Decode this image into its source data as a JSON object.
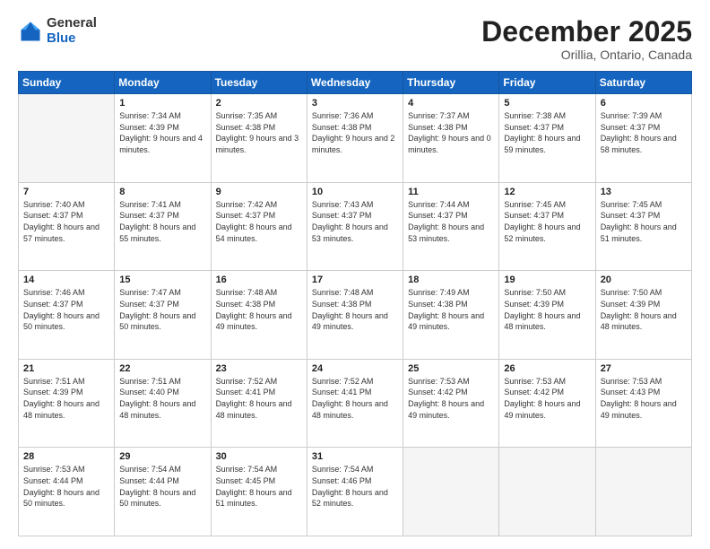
{
  "logo": {
    "general": "General",
    "blue": "Blue"
  },
  "header": {
    "title": "December 2025",
    "subtitle": "Orillia, Ontario, Canada"
  },
  "days": [
    "Sunday",
    "Monday",
    "Tuesday",
    "Wednesday",
    "Thursday",
    "Friday",
    "Saturday"
  ],
  "weeks": [
    [
      {
        "day": "",
        "sunrise": "",
        "sunset": "",
        "daylight": ""
      },
      {
        "day": "1",
        "sunrise": "Sunrise: 7:34 AM",
        "sunset": "Sunset: 4:39 PM",
        "daylight": "Daylight: 9 hours and 4 minutes."
      },
      {
        "day": "2",
        "sunrise": "Sunrise: 7:35 AM",
        "sunset": "Sunset: 4:38 PM",
        "daylight": "Daylight: 9 hours and 3 minutes."
      },
      {
        "day": "3",
        "sunrise": "Sunrise: 7:36 AM",
        "sunset": "Sunset: 4:38 PM",
        "daylight": "Daylight: 9 hours and 2 minutes."
      },
      {
        "day": "4",
        "sunrise": "Sunrise: 7:37 AM",
        "sunset": "Sunset: 4:38 PM",
        "daylight": "Daylight: 9 hours and 0 minutes."
      },
      {
        "day": "5",
        "sunrise": "Sunrise: 7:38 AM",
        "sunset": "Sunset: 4:37 PM",
        "daylight": "Daylight: 8 hours and 59 minutes."
      },
      {
        "day": "6",
        "sunrise": "Sunrise: 7:39 AM",
        "sunset": "Sunset: 4:37 PM",
        "daylight": "Daylight: 8 hours and 58 minutes."
      }
    ],
    [
      {
        "day": "7",
        "sunrise": "Sunrise: 7:40 AM",
        "sunset": "Sunset: 4:37 PM",
        "daylight": "Daylight: 8 hours and 57 minutes."
      },
      {
        "day": "8",
        "sunrise": "Sunrise: 7:41 AM",
        "sunset": "Sunset: 4:37 PM",
        "daylight": "Daylight: 8 hours and 55 minutes."
      },
      {
        "day": "9",
        "sunrise": "Sunrise: 7:42 AM",
        "sunset": "Sunset: 4:37 PM",
        "daylight": "Daylight: 8 hours and 54 minutes."
      },
      {
        "day": "10",
        "sunrise": "Sunrise: 7:43 AM",
        "sunset": "Sunset: 4:37 PM",
        "daylight": "Daylight: 8 hours and 53 minutes."
      },
      {
        "day": "11",
        "sunrise": "Sunrise: 7:44 AM",
        "sunset": "Sunset: 4:37 PM",
        "daylight": "Daylight: 8 hours and 53 minutes."
      },
      {
        "day": "12",
        "sunrise": "Sunrise: 7:45 AM",
        "sunset": "Sunset: 4:37 PM",
        "daylight": "Daylight: 8 hours and 52 minutes."
      },
      {
        "day": "13",
        "sunrise": "Sunrise: 7:45 AM",
        "sunset": "Sunset: 4:37 PM",
        "daylight": "Daylight: 8 hours and 51 minutes."
      }
    ],
    [
      {
        "day": "14",
        "sunrise": "Sunrise: 7:46 AM",
        "sunset": "Sunset: 4:37 PM",
        "daylight": "Daylight: 8 hours and 50 minutes."
      },
      {
        "day": "15",
        "sunrise": "Sunrise: 7:47 AM",
        "sunset": "Sunset: 4:37 PM",
        "daylight": "Daylight: 8 hours and 50 minutes."
      },
      {
        "day": "16",
        "sunrise": "Sunrise: 7:48 AM",
        "sunset": "Sunset: 4:38 PM",
        "daylight": "Daylight: 8 hours and 49 minutes."
      },
      {
        "day": "17",
        "sunrise": "Sunrise: 7:48 AM",
        "sunset": "Sunset: 4:38 PM",
        "daylight": "Daylight: 8 hours and 49 minutes."
      },
      {
        "day": "18",
        "sunrise": "Sunrise: 7:49 AM",
        "sunset": "Sunset: 4:38 PM",
        "daylight": "Daylight: 8 hours and 49 minutes."
      },
      {
        "day": "19",
        "sunrise": "Sunrise: 7:50 AM",
        "sunset": "Sunset: 4:39 PM",
        "daylight": "Daylight: 8 hours and 48 minutes."
      },
      {
        "day": "20",
        "sunrise": "Sunrise: 7:50 AM",
        "sunset": "Sunset: 4:39 PM",
        "daylight": "Daylight: 8 hours and 48 minutes."
      }
    ],
    [
      {
        "day": "21",
        "sunrise": "Sunrise: 7:51 AM",
        "sunset": "Sunset: 4:39 PM",
        "daylight": "Daylight: 8 hours and 48 minutes."
      },
      {
        "day": "22",
        "sunrise": "Sunrise: 7:51 AM",
        "sunset": "Sunset: 4:40 PM",
        "daylight": "Daylight: 8 hours and 48 minutes."
      },
      {
        "day": "23",
        "sunrise": "Sunrise: 7:52 AM",
        "sunset": "Sunset: 4:41 PM",
        "daylight": "Daylight: 8 hours and 48 minutes."
      },
      {
        "day": "24",
        "sunrise": "Sunrise: 7:52 AM",
        "sunset": "Sunset: 4:41 PM",
        "daylight": "Daylight: 8 hours and 48 minutes."
      },
      {
        "day": "25",
        "sunrise": "Sunrise: 7:53 AM",
        "sunset": "Sunset: 4:42 PM",
        "daylight": "Daylight: 8 hours and 49 minutes."
      },
      {
        "day": "26",
        "sunrise": "Sunrise: 7:53 AM",
        "sunset": "Sunset: 4:42 PM",
        "daylight": "Daylight: 8 hours and 49 minutes."
      },
      {
        "day": "27",
        "sunrise": "Sunrise: 7:53 AM",
        "sunset": "Sunset: 4:43 PM",
        "daylight": "Daylight: 8 hours and 49 minutes."
      }
    ],
    [
      {
        "day": "28",
        "sunrise": "Sunrise: 7:53 AM",
        "sunset": "Sunset: 4:44 PM",
        "daylight": "Daylight: 8 hours and 50 minutes."
      },
      {
        "day": "29",
        "sunrise": "Sunrise: 7:54 AM",
        "sunset": "Sunset: 4:44 PM",
        "daylight": "Daylight: 8 hours and 50 minutes."
      },
      {
        "day": "30",
        "sunrise": "Sunrise: 7:54 AM",
        "sunset": "Sunset: 4:45 PM",
        "daylight": "Daylight: 8 hours and 51 minutes."
      },
      {
        "day": "31",
        "sunrise": "Sunrise: 7:54 AM",
        "sunset": "Sunset: 4:46 PM",
        "daylight": "Daylight: 8 hours and 52 minutes."
      },
      {
        "day": "",
        "sunrise": "",
        "sunset": "",
        "daylight": ""
      },
      {
        "day": "",
        "sunrise": "",
        "sunset": "",
        "daylight": ""
      },
      {
        "day": "",
        "sunrise": "",
        "sunset": "",
        "daylight": ""
      }
    ]
  ]
}
